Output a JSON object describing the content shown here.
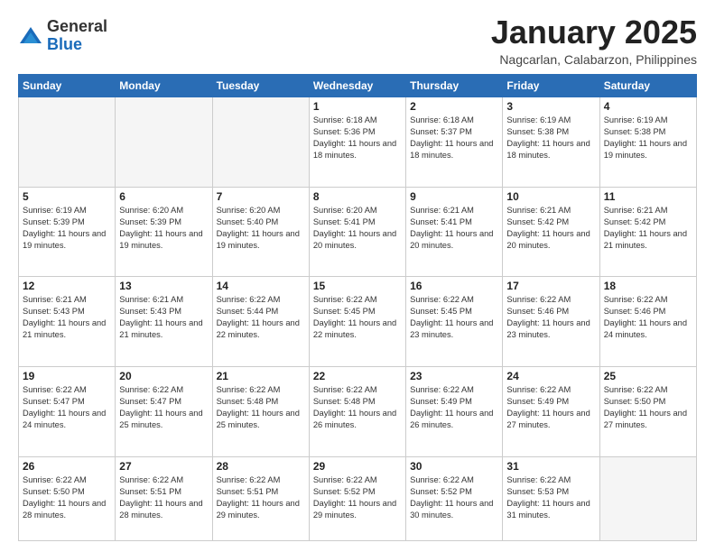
{
  "logo": {
    "general": "General",
    "blue": "Blue"
  },
  "header": {
    "title": "January 2025",
    "subtitle": "Nagcarlan, Calabarzon, Philippines"
  },
  "days_of_week": [
    "Sunday",
    "Monday",
    "Tuesday",
    "Wednesday",
    "Thursday",
    "Friday",
    "Saturday"
  ],
  "weeks": [
    [
      {
        "day": "",
        "empty": true
      },
      {
        "day": "",
        "empty": true
      },
      {
        "day": "",
        "empty": true
      },
      {
        "day": "1",
        "sunrise": "6:18 AM",
        "sunset": "5:36 PM",
        "daylight": "11 hours and 18 minutes."
      },
      {
        "day": "2",
        "sunrise": "6:18 AM",
        "sunset": "5:37 PM",
        "daylight": "11 hours and 18 minutes."
      },
      {
        "day": "3",
        "sunrise": "6:19 AM",
        "sunset": "5:38 PM",
        "daylight": "11 hours and 18 minutes."
      },
      {
        "day": "4",
        "sunrise": "6:19 AM",
        "sunset": "5:38 PM",
        "daylight": "11 hours and 19 minutes."
      }
    ],
    [
      {
        "day": "5",
        "sunrise": "6:19 AM",
        "sunset": "5:39 PM",
        "daylight": "11 hours and 19 minutes."
      },
      {
        "day": "6",
        "sunrise": "6:20 AM",
        "sunset": "5:39 PM",
        "daylight": "11 hours and 19 minutes."
      },
      {
        "day": "7",
        "sunrise": "6:20 AM",
        "sunset": "5:40 PM",
        "daylight": "11 hours and 19 minutes."
      },
      {
        "day": "8",
        "sunrise": "6:20 AM",
        "sunset": "5:41 PM",
        "daylight": "11 hours and 20 minutes."
      },
      {
        "day": "9",
        "sunrise": "6:21 AM",
        "sunset": "5:41 PM",
        "daylight": "11 hours and 20 minutes."
      },
      {
        "day": "10",
        "sunrise": "6:21 AM",
        "sunset": "5:42 PM",
        "daylight": "11 hours and 20 minutes."
      },
      {
        "day": "11",
        "sunrise": "6:21 AM",
        "sunset": "5:42 PM",
        "daylight": "11 hours and 21 minutes."
      }
    ],
    [
      {
        "day": "12",
        "sunrise": "6:21 AM",
        "sunset": "5:43 PM",
        "daylight": "11 hours and 21 minutes."
      },
      {
        "day": "13",
        "sunrise": "6:21 AM",
        "sunset": "5:43 PM",
        "daylight": "11 hours and 21 minutes."
      },
      {
        "day": "14",
        "sunrise": "6:22 AM",
        "sunset": "5:44 PM",
        "daylight": "11 hours and 22 minutes."
      },
      {
        "day": "15",
        "sunrise": "6:22 AM",
        "sunset": "5:45 PM",
        "daylight": "11 hours and 22 minutes."
      },
      {
        "day": "16",
        "sunrise": "6:22 AM",
        "sunset": "5:45 PM",
        "daylight": "11 hours and 23 minutes."
      },
      {
        "day": "17",
        "sunrise": "6:22 AM",
        "sunset": "5:46 PM",
        "daylight": "11 hours and 23 minutes."
      },
      {
        "day": "18",
        "sunrise": "6:22 AM",
        "sunset": "5:46 PM",
        "daylight": "11 hours and 24 minutes."
      }
    ],
    [
      {
        "day": "19",
        "sunrise": "6:22 AM",
        "sunset": "5:47 PM",
        "daylight": "11 hours and 24 minutes."
      },
      {
        "day": "20",
        "sunrise": "6:22 AM",
        "sunset": "5:47 PM",
        "daylight": "11 hours and 25 minutes."
      },
      {
        "day": "21",
        "sunrise": "6:22 AM",
        "sunset": "5:48 PM",
        "daylight": "11 hours and 25 minutes."
      },
      {
        "day": "22",
        "sunrise": "6:22 AM",
        "sunset": "5:48 PM",
        "daylight": "11 hours and 26 minutes."
      },
      {
        "day": "23",
        "sunrise": "6:22 AM",
        "sunset": "5:49 PM",
        "daylight": "11 hours and 26 minutes."
      },
      {
        "day": "24",
        "sunrise": "6:22 AM",
        "sunset": "5:49 PM",
        "daylight": "11 hours and 27 minutes."
      },
      {
        "day": "25",
        "sunrise": "6:22 AM",
        "sunset": "5:50 PM",
        "daylight": "11 hours and 27 minutes."
      }
    ],
    [
      {
        "day": "26",
        "sunrise": "6:22 AM",
        "sunset": "5:50 PM",
        "daylight": "11 hours and 28 minutes."
      },
      {
        "day": "27",
        "sunrise": "6:22 AM",
        "sunset": "5:51 PM",
        "daylight": "11 hours and 28 minutes."
      },
      {
        "day": "28",
        "sunrise": "6:22 AM",
        "sunset": "5:51 PM",
        "daylight": "11 hours and 29 minutes."
      },
      {
        "day": "29",
        "sunrise": "6:22 AM",
        "sunset": "5:52 PM",
        "daylight": "11 hours and 29 minutes."
      },
      {
        "day": "30",
        "sunrise": "6:22 AM",
        "sunset": "5:52 PM",
        "daylight": "11 hours and 30 minutes."
      },
      {
        "day": "31",
        "sunrise": "6:22 AM",
        "sunset": "5:53 PM",
        "daylight": "11 hours and 31 minutes."
      },
      {
        "day": "",
        "empty": true
      }
    ]
  ],
  "labels": {
    "sunrise": "Sunrise:",
    "sunset": "Sunset:",
    "daylight": "Daylight:"
  }
}
